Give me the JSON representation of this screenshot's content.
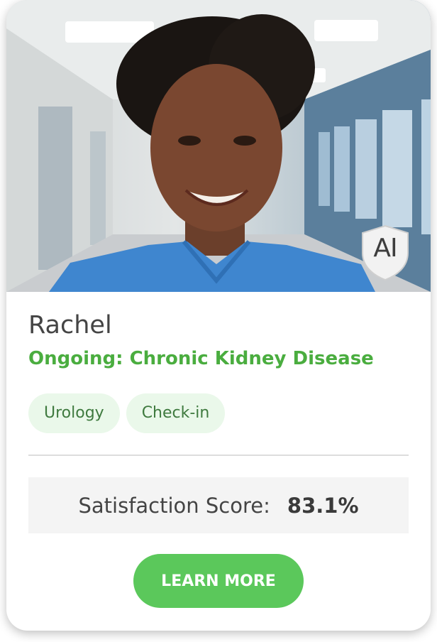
{
  "profile": {
    "name": "Rachel",
    "condition": "Ongoing: Chronic Kidney Disease",
    "ai_badge": "AI"
  },
  "tags": [
    "Urology",
    "Check-in"
  ],
  "score": {
    "label": "Satisfaction Score:",
    "value": "83.1%"
  },
  "actions": {
    "learn_more": "LEARN MORE"
  },
  "colors": {
    "accent_green": "#4aad3f",
    "button_green": "#5bc85b",
    "tag_bg": "#eaf8ea",
    "score_bg": "#f4f4f4"
  }
}
